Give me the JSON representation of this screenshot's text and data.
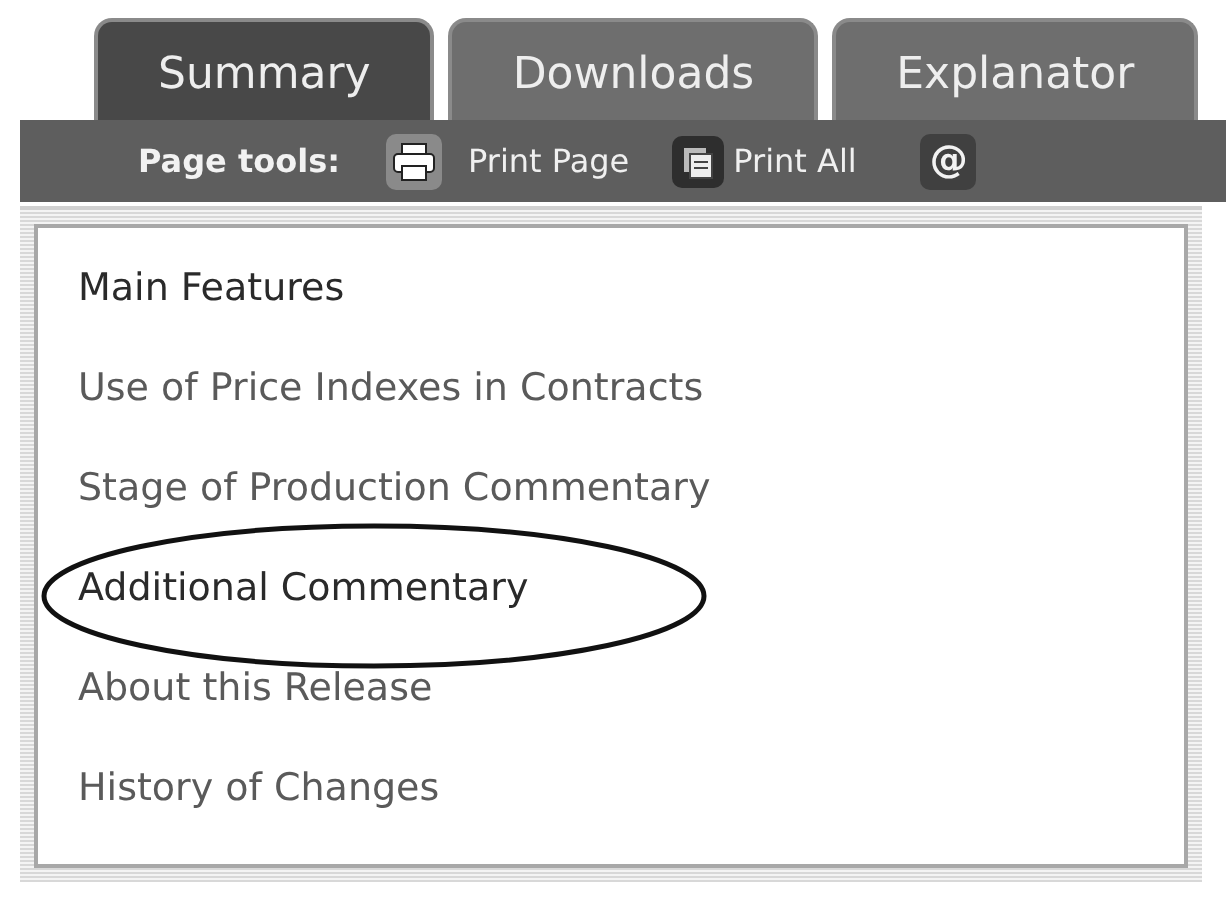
{
  "tabs": [
    {
      "label": "Summary",
      "selected": true
    },
    {
      "label": "Downloads",
      "selected": false
    },
    {
      "label": "Explanator",
      "selected": false
    }
  ],
  "page_tools": {
    "label": "Page tools:",
    "tools": [
      {
        "kind": "print",
        "label": "Print Page"
      },
      {
        "kind": "print_all",
        "label": "Print All"
      },
      {
        "kind": "email",
        "icon_text": "@"
      }
    ]
  },
  "menu": [
    {
      "label": "Main Features",
      "current": true,
      "circled": false
    },
    {
      "label": "Use of Price Indexes in Contracts",
      "current": false,
      "circled": false
    },
    {
      "label": "Stage of Production Commentary",
      "current": false,
      "circled": false
    },
    {
      "label": "Additional Commentary",
      "current": true,
      "circled": true
    },
    {
      "label": "About this Release",
      "current": false,
      "circled": false
    },
    {
      "label": "History of Changes",
      "current": false,
      "circled": false
    }
  ]
}
